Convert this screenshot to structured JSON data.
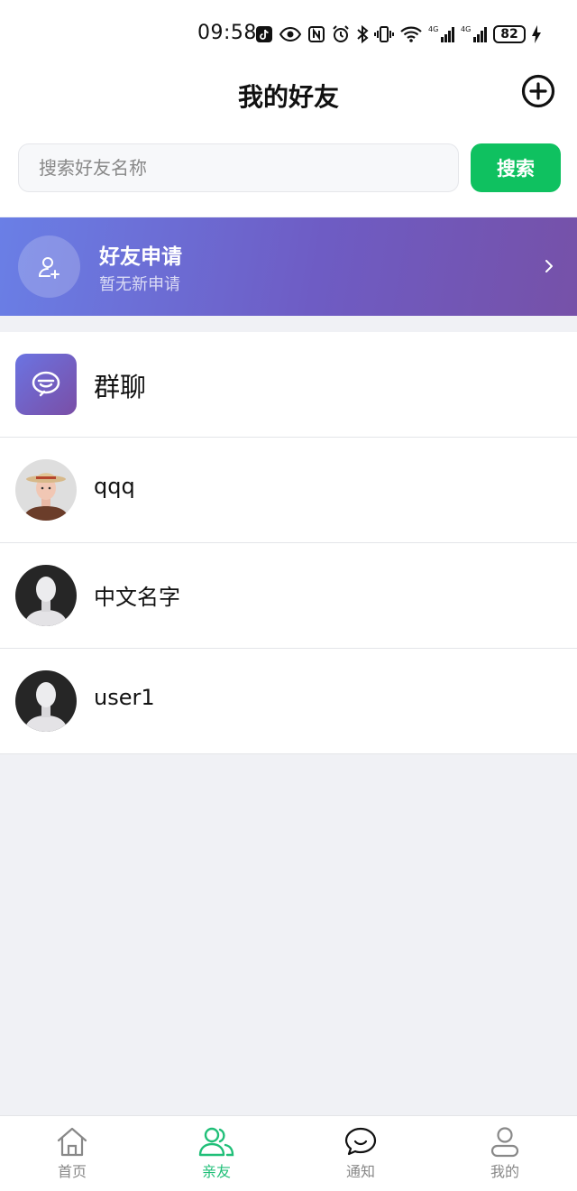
{
  "status_bar": {
    "time": "09:58",
    "battery": "82",
    "network_labels": [
      "4G",
      "4G"
    ]
  },
  "header": {
    "title": "我的好友",
    "add_icon": "plus-circle-icon"
  },
  "search": {
    "placeholder": "搜索好友名称",
    "value": "",
    "button_label": "搜索",
    "button_color": "#0fc160"
  },
  "friend_requests": {
    "title": "好友申请",
    "subtitle": "暂无新申请",
    "icon": "user-plus-icon"
  },
  "list": {
    "group_chat_label": "群聊",
    "friends": [
      {
        "name": "qqq",
        "avatar": "straw-hat-avatar"
      },
      {
        "name": "中文名字",
        "avatar": "default-avatar"
      },
      {
        "name": "user1",
        "avatar": "default-avatar"
      }
    ]
  },
  "tabs": [
    {
      "label": "首页",
      "icon": "home-icon",
      "active": false
    },
    {
      "label": "亲友",
      "icon": "friends-icon",
      "active": true
    },
    {
      "label": "通知",
      "icon": "chat-bubble-icon",
      "active": false
    },
    {
      "label": "我的",
      "icon": "user-icon",
      "active": false
    }
  ],
  "colors": {
    "accent_green": "#0fc160",
    "active_tab": "#20bf78",
    "banner_start": "#6a7fe6",
    "banner_end": "#7651a8"
  }
}
